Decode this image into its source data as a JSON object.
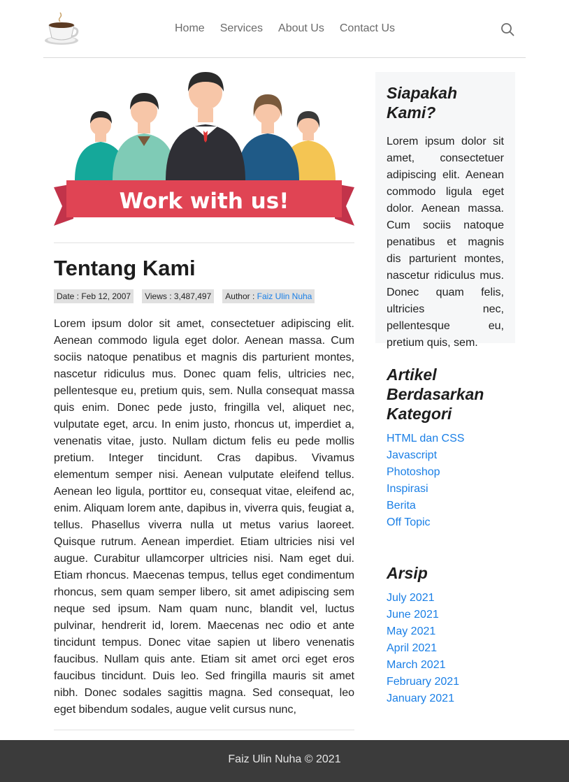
{
  "nav": {
    "items": [
      "Home",
      "Services",
      "About Us",
      "Contact Us"
    ]
  },
  "hero": {
    "banner_text": "Work with us!"
  },
  "article": {
    "title": "Tentang Kami",
    "date": "Date : Feb 12, 2007",
    "views": "Views : 3,487,497",
    "author_label": "Author :",
    "author_name": "Faiz Ulin Nuha",
    "body": "Lorem ipsum dolor sit amet, consectetuer adipiscing elit. Aenean commodo ligula eget dolor. Aenean massa. Cum sociis natoque penatibus et magnis dis parturient montes, nascetur ridiculus mus. Donec quam felis, ultricies nec, pellentesque eu, pretium quis, sem. Nulla consequat massa quis enim. Donec pede justo, fringilla vel, aliquet nec, vulputate eget, arcu. In enim justo, rhoncus ut, imperdiet a, venenatis vitae, justo. Nullam dictum felis eu pede mollis pretium. Integer tincidunt. Cras dapibus. Vivamus elementum semper nisi. Aenean vulputate eleifend tellus. Aenean leo ligula, porttitor eu, consequat vitae, eleifend ac, enim. Aliquam lorem ante, dapibus in, viverra quis, feugiat a, tellus. Phasellus viverra nulla ut metus varius laoreet. Quisque rutrum. Aenean imperdiet. Etiam ultricies nisi vel augue. Curabitur ullamcorper ultricies nisi. Nam eget dui. Etiam rhoncus. Maecenas tempus, tellus eget condimentum rhoncus, sem quam semper libero, sit amet adipiscing sem neque sed ipsum. Nam quam nunc, blandit vel, luctus pulvinar, hendrerit id, lorem. Maecenas nec odio et ante tincidunt tempus. Donec vitae sapien ut libero venenatis faucibus. Nullam quis ante. Etiam sit amet orci eget eros faucibus tincidunt. Duis leo. Sed fringilla mauris sit amet nibh. Donec sodales sagittis magna. Sed consequat, leo eget bibendum sodales, augue velit cursus nunc,"
  },
  "sidebar": {
    "about": {
      "heading": "Siapakah Kami?",
      "text": "Lorem ipsum dolor sit amet, consectetuer adipiscing elit. Aenean commodo ligula eget dolor. Aenean massa. Cum sociis natoque penatibus et magnis dis parturient montes, nascetur ridiculus mus. Donec quam felis, ultricies nec, pellentesque eu, pretium quis, sem."
    },
    "categories": {
      "heading": "Artikel Berdasarkan Kategori",
      "items": [
        "HTML dan CSS",
        "Javascript",
        "Photoshop",
        "Inspirasi",
        "Berita",
        "Off Topic"
      ]
    },
    "archive": {
      "heading": "Arsip",
      "items": [
        "July 2021",
        "June 2021",
        "May 2021",
        "April 2021",
        "March 2021",
        "February 2021",
        "January 2021"
      ]
    }
  },
  "footer": {
    "text": "Faiz Ulin Nuha © 2021"
  },
  "colors": {
    "link": "#1a7fe6",
    "footer_bg": "#3b3b3b",
    "banner_red": "#e04454",
    "sidebar_bg": "#f6f7f8"
  },
  "icons": {
    "logo": "coffee-cup-icon",
    "search": "search-icon"
  }
}
